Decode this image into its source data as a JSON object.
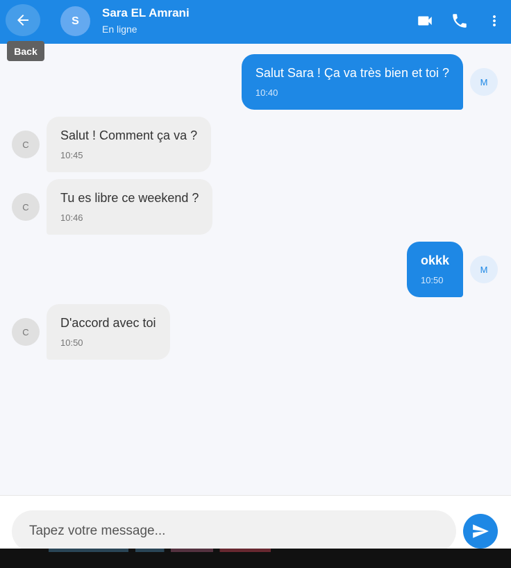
{
  "header": {
    "back_tooltip": "Back",
    "avatar_initial": "S",
    "contact_name": "Sara EL Amrani",
    "status": "En ligne",
    "icons": [
      "arrow-back-icon",
      "video-call-icon",
      "phone-icon",
      "more-vert-icon"
    ]
  },
  "messages": [
    {
      "sender": "me",
      "avatar": "M",
      "text": "Salut Sara ! Ça va très bien et toi ?",
      "time": "10:40"
    },
    {
      "sender": "contact",
      "avatar": "C",
      "text": "Salut ! Comment ça va ?",
      "time": "10:45"
    },
    {
      "sender": "contact",
      "avatar": "C",
      "text": "Tu es libre ce weekend ?",
      "time": "10:46"
    },
    {
      "sender": "me",
      "avatar": "M",
      "text": "okkk",
      "time": "10:50"
    },
    {
      "sender": "contact",
      "avatar": "C",
      "text": "D'accord avec toi",
      "time": "10:50"
    }
  ],
  "composer": {
    "placeholder": "Tapez votre message...",
    "value": "",
    "send_icon": "send-icon"
  },
  "colors": {
    "primary": "#1e88e5",
    "incoming_bubble": "#eeeeee",
    "background": "#f6f7fb"
  }
}
